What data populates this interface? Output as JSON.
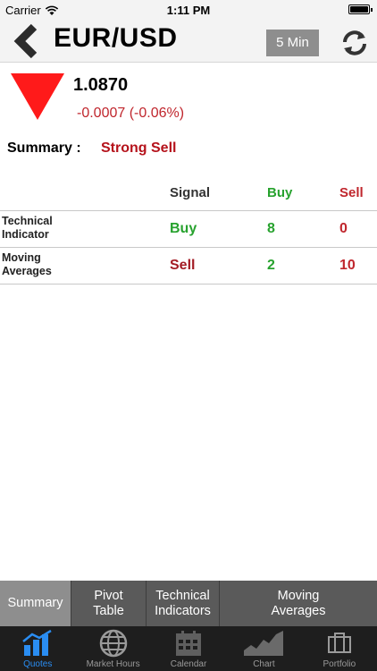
{
  "status_bar": {
    "carrier": "Carrier",
    "time": "1:11 PM"
  },
  "nav": {
    "title": "EUR/USD",
    "interval_label": "5 Min"
  },
  "quote": {
    "price": "1.0870",
    "change": "-0.0007 (-0.06%)",
    "direction_color": "#ff1a1a"
  },
  "summary": {
    "label": "Summary :",
    "value": "Strong Sell"
  },
  "table": {
    "headers": {
      "signal": "Signal",
      "buy": "Buy",
      "sell": "Sell"
    },
    "rows": [
      {
        "label_line1": "Technical",
        "label_line2": "Indicator",
        "signal": "Buy",
        "buy": "8",
        "sell": "0"
      },
      {
        "label_line1": "Moving",
        "label_line2": "Averages",
        "signal": "Sell",
        "buy": "2",
        "sell": "10"
      }
    ]
  },
  "segments": [
    {
      "line1": "Summary",
      "line2": ""
    },
    {
      "line1": "Pivot",
      "line2": "Table"
    },
    {
      "line1": "Technical",
      "line2": "Indicators"
    },
    {
      "line1": "Moving",
      "line2": "Averages"
    }
  ],
  "tabs": [
    {
      "label": "Quotes",
      "icon": "chart-bars-icon"
    },
    {
      "label": "Market Hours",
      "icon": "globe-icon"
    },
    {
      "label": "Calendar",
      "icon": "calendar-icon"
    },
    {
      "label": "Chart",
      "icon": "area-chart-icon"
    },
    {
      "label": "Portfolio",
      "icon": "briefcase-icon"
    }
  ],
  "colors": {
    "accent": "#2a8df2",
    "buy": "#27a22e",
    "sell": "#c0262d"
  }
}
